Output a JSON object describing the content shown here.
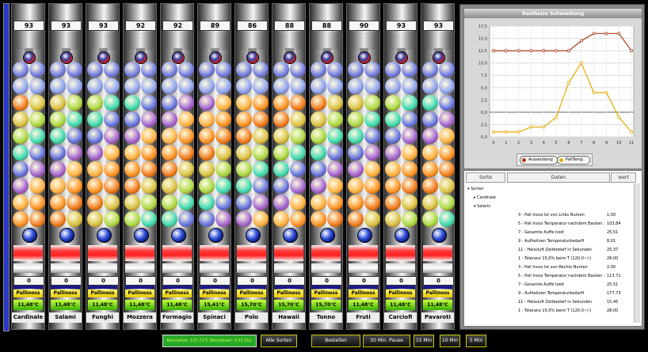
{
  "lanes": [
    {
      "count": "93",
      "name": "Cardinale"
    },
    {
      "count": "93",
      "name": "Salami"
    },
    {
      "count": "93",
      "name": "Funghi"
    },
    {
      "count": "92",
      "name": "Mozzera"
    },
    {
      "count": "92",
      "name": "Formagio"
    },
    {
      "count": "89",
      "name": "Spinaci"
    },
    {
      "count": "86",
      "name": "Polo"
    },
    {
      "count": "88",
      "name": "Hawaii"
    },
    {
      "count": "88",
      "name": "Tonno"
    },
    {
      "count": "90",
      "name": "Fruti"
    },
    {
      "count": "93",
      "name": "Carciofi"
    },
    {
      "count": "93",
      "name": "Pavaroti"
    }
  ],
  "lane_common": {
    "zero": "0",
    "pallstatus": "Pallinoss",
    "temp": "11,48°C"
  },
  "lane_temps": [
    "11,48°C",
    "11,48°C",
    "11,48°C",
    "11,48°C",
    "11,48°C",
    "15,41°C",
    "15,70°C",
    "15,70°C",
    "15,70°C",
    "11,48°C",
    "11,48°C",
    "11,48°C"
  ],
  "chart": {
    "title": "Restheize Schwankung",
    "series": [
      {
        "name": "Aussentemp",
        "color": "#b03a1a",
        "values": [
          12.5,
          12.5,
          12.5,
          12.5,
          12.5,
          12.5,
          12.5,
          14.5,
          16.0,
          16.0,
          16.0,
          12.5,
          12.5
        ]
      },
      {
        "name": "PallTemp",
        "color": "#e8a800",
        "values": [
          -4,
          -4,
          -4,
          -3,
          -3,
          -1,
          6,
          10,
          4,
          4,
          -1,
          -4,
          -4
        ]
      }
    ],
    "x": [
      0,
      1,
      2,
      3,
      4,
      5,
      6,
      7,
      8,
      9,
      10,
      11
    ],
    "ylim": [
      -5,
      17.5
    ],
    "yticks": [
      "17,5",
      "15,0",
      "12,5",
      "10,0",
      "7,5",
      "5,0",
      "2,5",
      "0,0",
      "-2,5",
      "-5,0"
    ]
  },
  "tree": {
    "headers": [
      "Sorte",
      "Daten",
      "wert"
    ],
    "rows": [
      {
        "label": "▾ Sorten",
        "indent": 0,
        "val": ""
      },
      {
        "label": "▸ Cardinale",
        "indent": 1,
        "val": ""
      },
      {
        "label": "▾ Salami",
        "indent": 1,
        "val": ""
      },
      {
        "label": "3 - Pall Inoss Ist von Links Numen",
        "indent": 2,
        "val": "1,00"
      },
      {
        "label": "5 - Pall Inoss Temperatur nachdem Backen :",
        "indent": 2,
        "val": "103,84"
      },
      {
        "label": "7 - Gesamte Auffe tzeit",
        "indent": 2,
        "val": "25,51"
      },
      {
        "label": "9 - Aufheitzen Temperaturbedarft",
        "indent": 2,
        "val": "8,01"
      },
      {
        "label": "11 - Heissluft Zeitbedarf in Sekunden",
        "indent": 2,
        "val": "25,37"
      },
      {
        "label": "1 - Toleranz 15,0% beim T (120,0~/-)",
        "indent": 2,
        "val": "28,00"
      },
      {
        "label": "3 - Pall Inoss Ist von Rechts Numen",
        "indent": 2,
        "val": "2,00"
      },
      {
        "label": "5 - Pall Inoss Temperatur nachdem Backen :",
        "indent": 2,
        "val": "113,71"
      },
      {
        "label": "7 - Gesamte Auffe tzeit",
        "indent": 2,
        "val": "25,51"
      },
      {
        "label": "9 - Aufheitzen Temperaturbedarft",
        "indent": 2,
        "val": "177,73"
      },
      {
        "label": "11 - Heissluft Zeitbedarf in Sekunden",
        "indent": 2,
        "val": "15,45"
      },
      {
        "label": "1 - Toleranz 15,0% beim T (120,0~/-)",
        "indent": 2,
        "val": "28,00"
      }
    ]
  },
  "bottom": {
    "status": "Resthietze: 137,71°C Betriebzeit: 4,52 Std.",
    "buttons": [
      "Alle Sorten",
      "Bestellen",
      "30 Min. Pause",
      "15 Min",
      "10 Min",
      "5 Min"
    ]
  }
}
